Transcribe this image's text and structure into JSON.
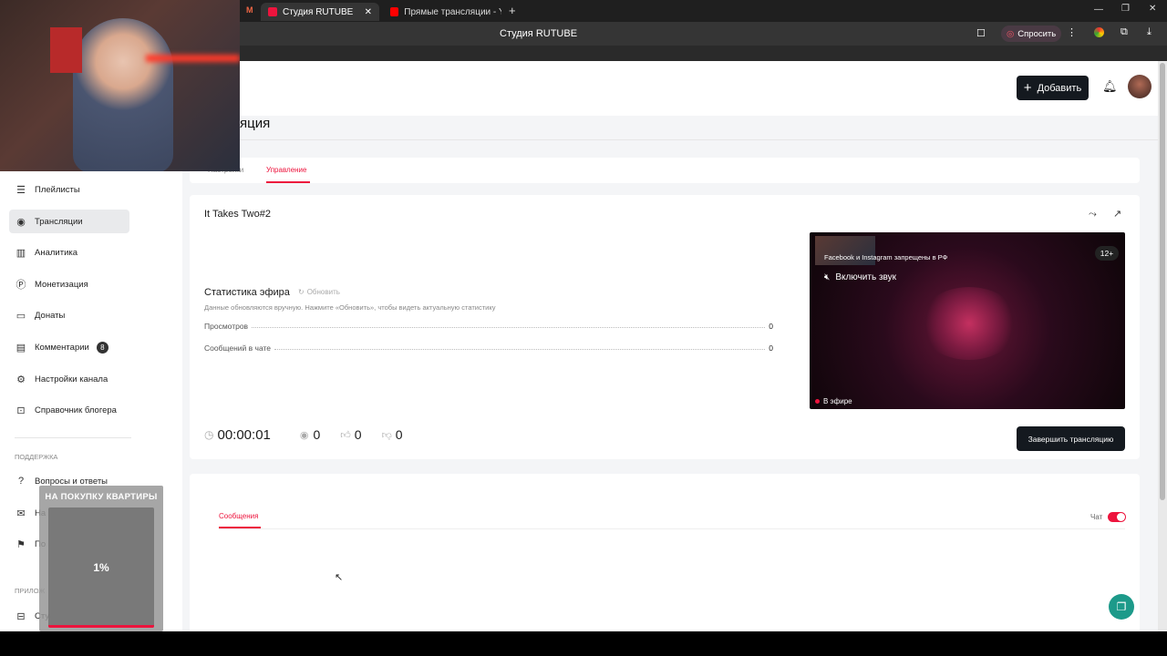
{
  "browser": {
    "tabs": [
      {
        "label": "Студия RUTUBE",
        "active": true
      },
      {
        "label": "Прямые трансляции - Yo",
        "active": false
      }
    ],
    "window_title": "Студия RUTUBE",
    "ask_label": "Спросить"
  },
  "header": {
    "add_button": "Добавить",
    "page_title": "яция"
  },
  "tabs": {
    "settings": "Настройки",
    "manage": "Управление"
  },
  "sidebar": {
    "items": [
      {
        "label": "Плейлисты",
        "icon": "playlist-icon"
      },
      {
        "label": "Трансляции",
        "icon": "broadcast-icon"
      },
      {
        "label": "Аналитика",
        "icon": "analytics-icon"
      },
      {
        "label": "Монетизация",
        "icon": "monetization-icon"
      },
      {
        "label": "Донаты",
        "icon": "donate-icon"
      },
      {
        "label": "Комментарии",
        "icon": "comments-icon",
        "badge": "8"
      },
      {
        "label": "Настройки канала",
        "icon": "gear-icon"
      },
      {
        "label": "Справочник блогера",
        "icon": "help-book-icon"
      }
    ],
    "support_heading": "ПОДДЕРЖКА",
    "support_items": [
      {
        "label": "Вопросы и ответы",
        "icon": "question-icon"
      },
      {
        "label": "На",
        "icon": "mail-icon"
      },
      {
        "label": "По",
        "icon": "flag-icon"
      }
    ],
    "apps_heading": "ПРИЛОЖ",
    "apps_items": [
      {
        "label": "Сту",
        "icon": "app-icon"
      }
    ]
  },
  "stream": {
    "title": "It Takes Two#2",
    "stats_title": "Статистика эфира",
    "refresh_label": "Обновить",
    "stats_note": "Данные обновляются вручную. Нажмите «Обновить», чтобы видеть актуальную статистику",
    "stats": [
      {
        "label": "Просмотров",
        "value": "0"
      },
      {
        "label": "Сообщений в чате",
        "value": "0"
      }
    ],
    "timer": "00:00:01",
    "viewers": "0",
    "likes": "0",
    "dislikes": "0",
    "end_button": "Завершить трансляцию"
  },
  "player": {
    "banner": "Facebook и Instagram запрещены в РФ",
    "unmute": "Включить звук",
    "age": "12+",
    "live": "В эфире"
  },
  "chat": {
    "messages_tab": "Сообщения",
    "chat_label": "Чат",
    "chat_enabled": true
  },
  "overlay": {
    "goal_title": "НА ПОКУПКУ КВАРТИРЫ",
    "goal_percent": "1%",
    "goal_progress": 0.01
  },
  "colors": {
    "accent": "#ed143d",
    "dark_button": "#14191f",
    "support_fab": "#1d9a8a"
  }
}
